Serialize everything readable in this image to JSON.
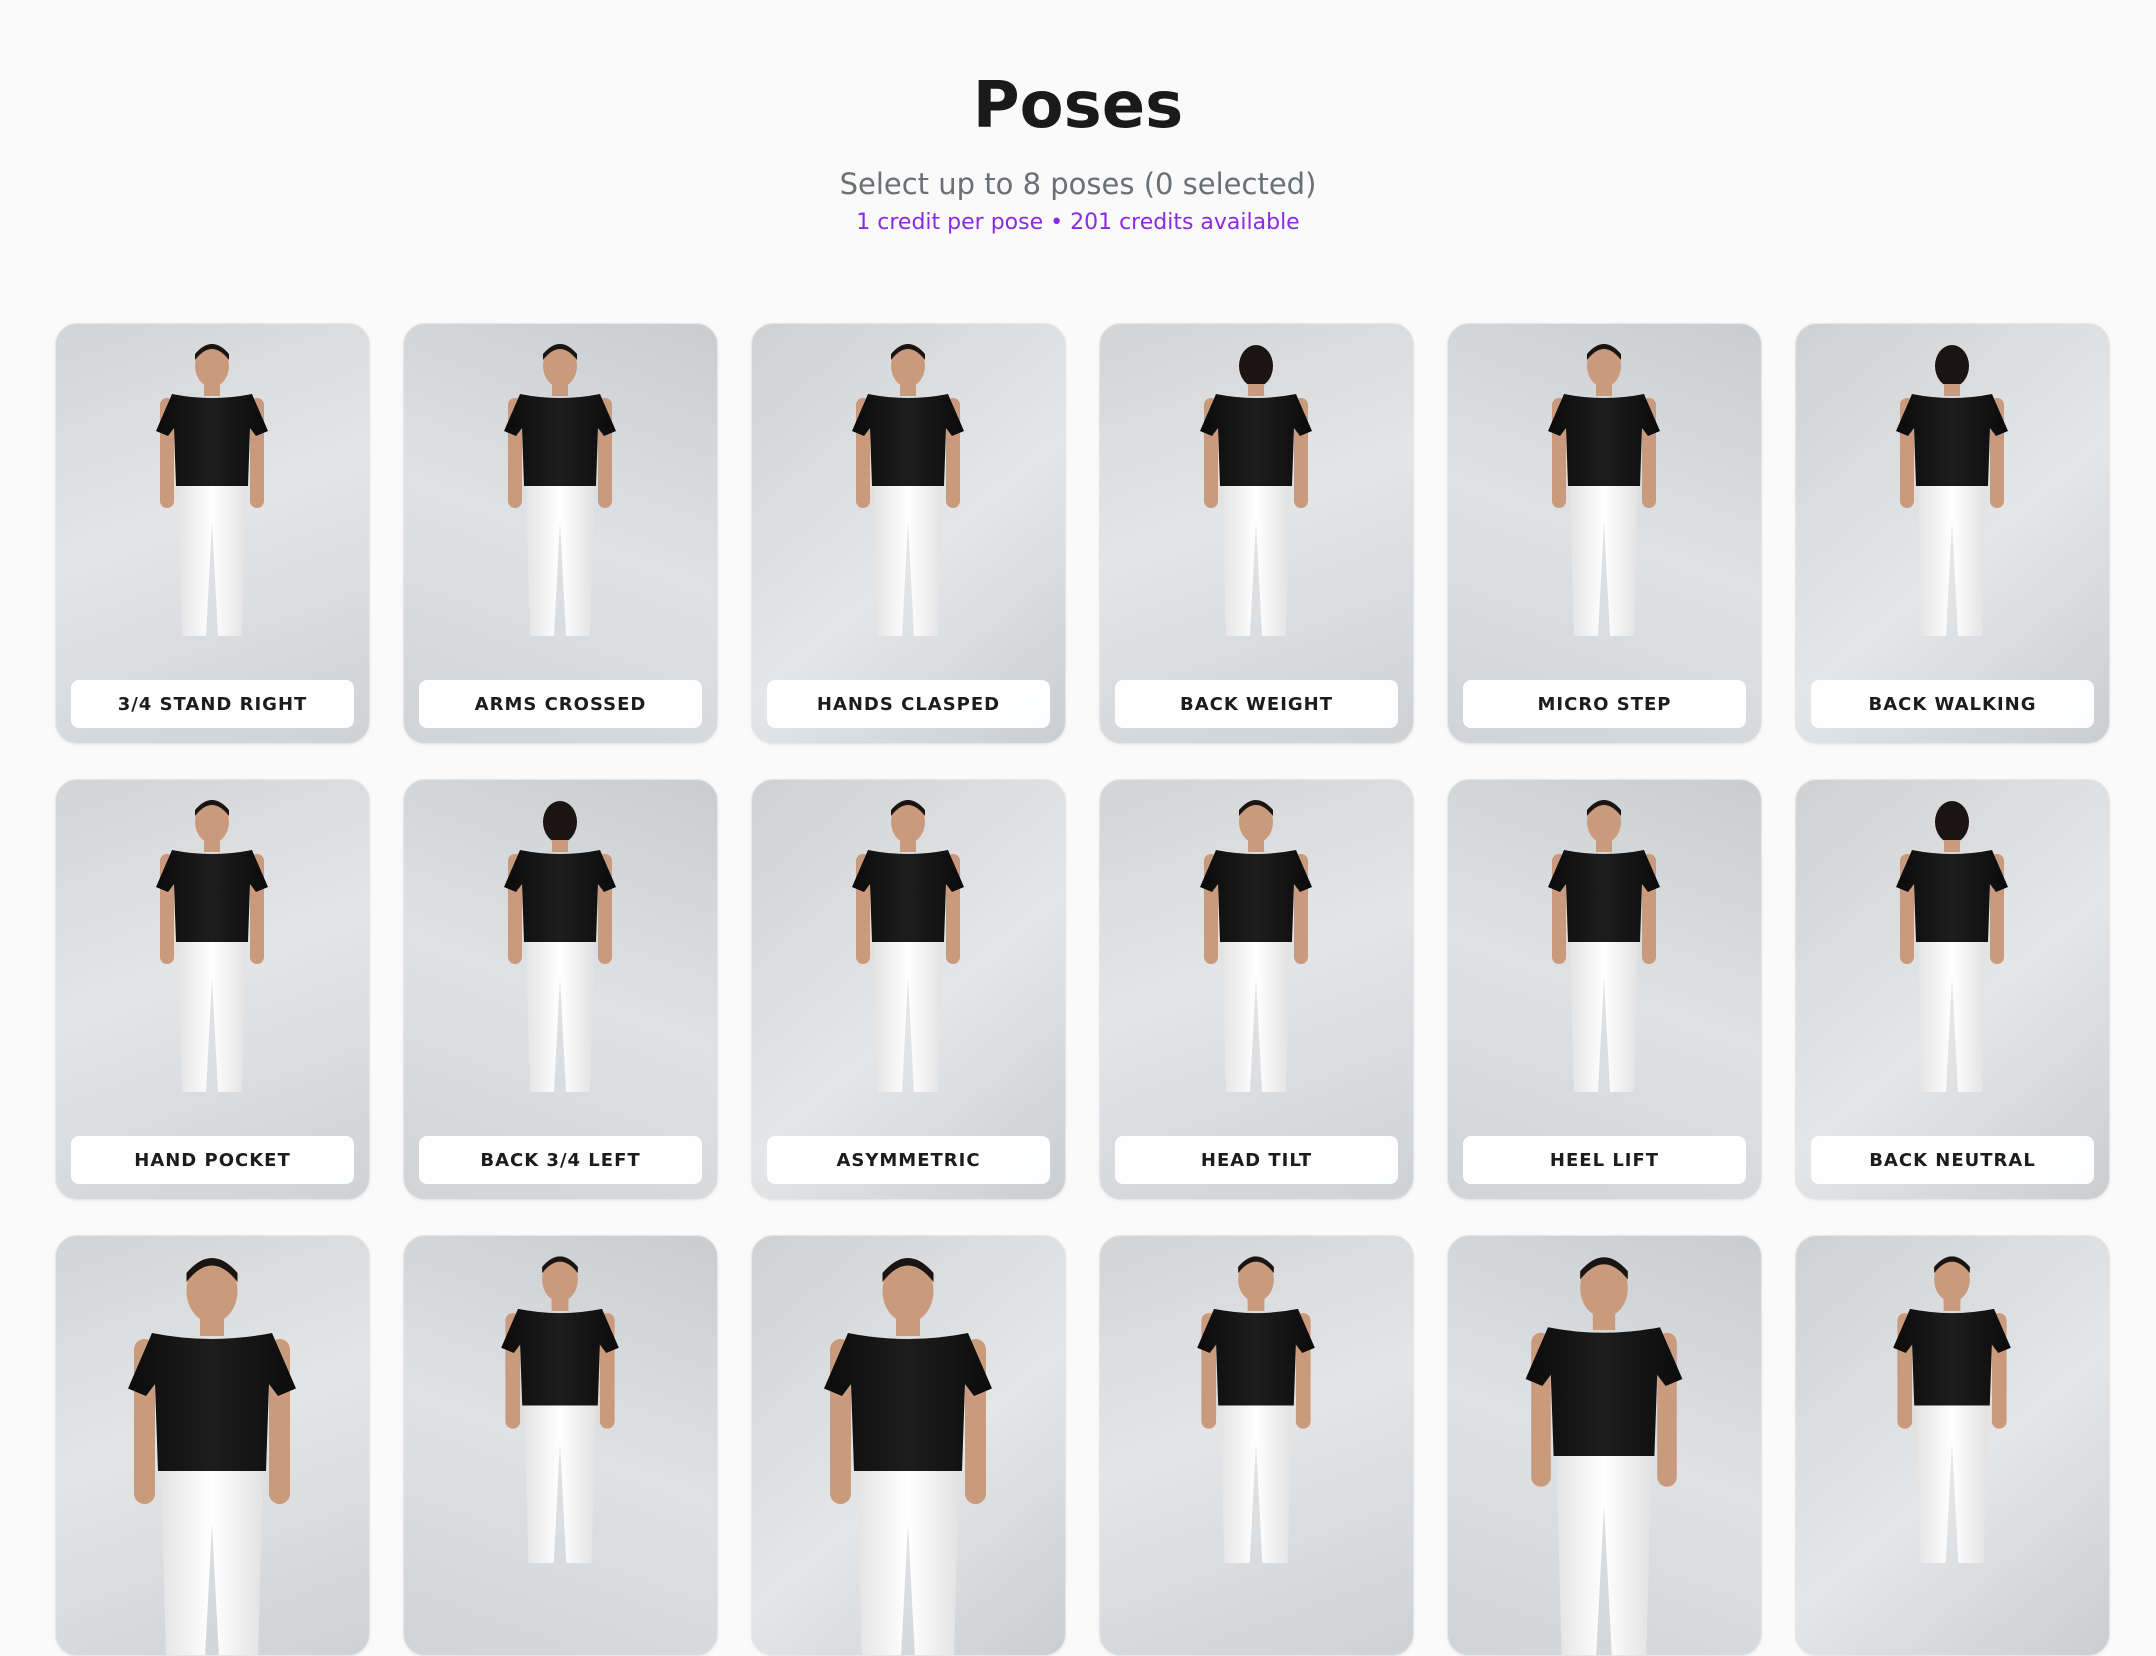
{
  "header": {
    "title": "Poses",
    "subtitle": "Select up to 8 poses (0 selected)",
    "credits": "1 credit per pose • 201 credits available"
  },
  "colors": {
    "accent": "#8a2be2",
    "shirt": "#111111",
    "pants": "#f4f4f4",
    "skin": "#c99a7c"
  },
  "poses": [
    {
      "label": "3/4 STAND RIGHT",
      "icon": "model-three-quarter-right-photo"
    },
    {
      "label": "ARMS CROSSED",
      "icon": "model-arms-crossed-photo"
    },
    {
      "label": "HANDS CLASPED",
      "icon": "model-hands-clasped-photo"
    },
    {
      "label": "BACK WEIGHT",
      "icon": "model-back-weight-photo"
    },
    {
      "label": "MICRO STEP",
      "icon": "model-micro-step-photo"
    },
    {
      "label": "BACK WALKING",
      "icon": "model-back-walking-photo"
    },
    {
      "label": "HAND POCKET",
      "icon": "model-hand-pocket-photo"
    },
    {
      "label": "BACK 3/4 LEFT",
      "icon": "model-back-three-quarter-left-photo"
    },
    {
      "label": "ASYMMETRIC",
      "icon": "model-asymmetric-photo"
    },
    {
      "label": "HEAD TILT",
      "icon": "model-head-tilt-photo"
    },
    {
      "label": "HEEL LIFT",
      "icon": "model-heel-lift-photo"
    },
    {
      "label": "BACK NEUTRAL",
      "icon": "model-back-neutral-photo"
    },
    {
      "label": "",
      "icon": "model-closeup-photo"
    },
    {
      "label": "",
      "icon": "model-standing-photo"
    },
    {
      "label": "",
      "icon": "model-closeup-front-photo"
    },
    {
      "label": "",
      "icon": "model-hands-clasped-photo"
    },
    {
      "label": "",
      "icon": "model-closeup-front-photo"
    },
    {
      "label": "",
      "icon": "model-three-quarter-photo"
    }
  ]
}
